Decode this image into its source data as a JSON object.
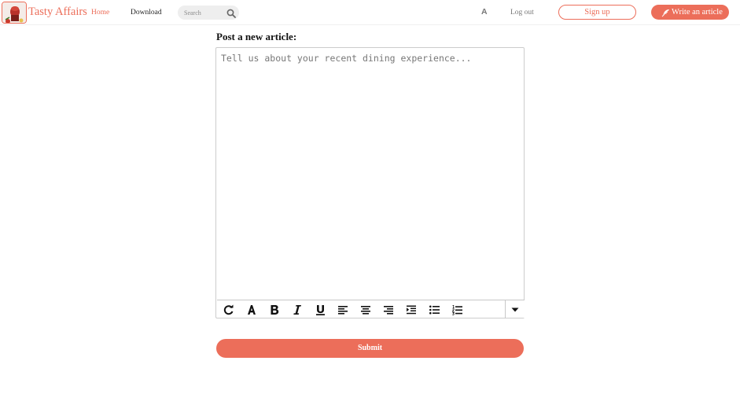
{
  "header": {
    "brand": "Tasty Affairs",
    "nav": {
      "home": "Home",
      "download": "Download"
    },
    "search": {
      "placeholder": "Search",
      "icon": "search-icon"
    },
    "font_size_label": "A",
    "logout": "Log out",
    "signup": "Sign up",
    "write_article": "Write an article"
  },
  "main": {
    "title": "Post a new article:",
    "editor": {
      "value": "",
      "placeholder": "Tell us about your recent dining experience..."
    },
    "toolbar": [
      "redo-icon",
      "text-color-icon",
      "bold-icon",
      "italic-icon",
      "underline-icon",
      "align-left-icon",
      "align-center-icon",
      "align-right-icon",
      "indent-icon",
      "bulleted-list-icon",
      "numbered-list-icon",
      "more-dropdown-icon"
    ],
    "submit": "Submit"
  },
  "colors": {
    "accent": "#ec6e5a",
    "text": "#222222",
    "muted": "#777777"
  }
}
